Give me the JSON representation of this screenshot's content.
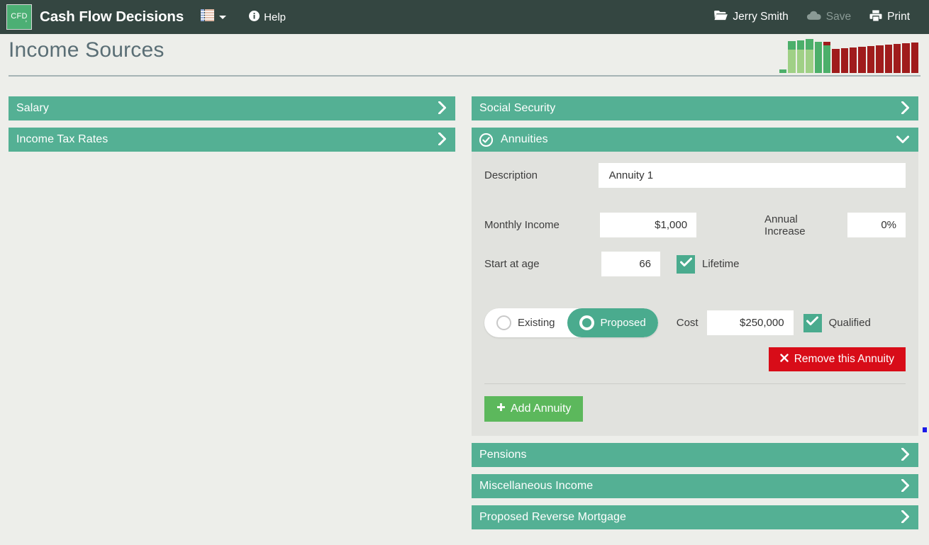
{
  "navbar": {
    "logo_text": "CFD",
    "logo_mark": "’",
    "brand": "Cash Flow Decisions",
    "list_icon": "list-grid-icon",
    "caret_icon": "chevron-down-icon",
    "help_label": "Help",
    "help_icon": "info-circle-icon",
    "user": {
      "label": "Jerry Smith",
      "icon": "open-folder-icon"
    },
    "save": {
      "label": "Save",
      "icon": "cloud-icon",
      "disabled": true
    },
    "print": {
      "label": "Print",
      "icon": "printer-icon"
    }
  },
  "page": {
    "title": "Income Sources",
    "background": "#edeeea",
    "accent": "#54b094"
  },
  "minichart": {
    "type": "bar",
    "title": "",
    "bars": [
      {
        "green_light": 0,
        "green_dark": 5,
        "red": 0
      },
      {
        "green_light": 33,
        "green_dark": 12,
        "red": 0
      },
      {
        "green_light": 33,
        "green_dark": 13,
        "red": 0
      },
      {
        "green_light": 33,
        "green_dark": 15,
        "red": 0
      },
      {
        "green_light": 0,
        "green_dark": 44,
        "red": 0
      },
      {
        "green_light": 0,
        "green_dark": 39,
        "red": 5
      },
      {
        "green_light": 0,
        "green_dark": 0,
        "red": 34
      },
      {
        "green_light": 0,
        "green_dark": 0,
        "red": 35
      },
      {
        "green_light": 0,
        "green_dark": 0,
        "red": 36
      },
      {
        "green_light": 0,
        "green_dark": 0,
        "red": 37
      },
      {
        "green_light": 0,
        "green_dark": 0,
        "red": 38
      },
      {
        "green_light": 0,
        "green_dark": 0,
        "red": 39
      },
      {
        "green_light": 0,
        "green_dark": 0,
        "red": 40
      },
      {
        "green_light": 0,
        "green_dark": 0,
        "red": 41
      },
      {
        "green_light": 0,
        "green_dark": 0,
        "red": 42
      },
      {
        "green_light": 0,
        "green_dark": 0,
        "red": 43
      }
    ],
    "colors": {
      "green_light": "#a0d086",
      "green_dark": "#4caf6a",
      "red": "#a01c1c"
    }
  },
  "left_column": {
    "sections": [
      {
        "label": "Salary",
        "icon": "chevron-right-icon"
      },
      {
        "label": "Income Tax Rates",
        "icon": "chevron-right-icon"
      }
    ]
  },
  "right_column": {
    "social_security": {
      "label": "Social Security",
      "icon": "chevron-right-icon"
    },
    "annuities": {
      "label": "Annuities",
      "status_icon": "check-circle-icon",
      "chevron_icon": "chevron-down-icon",
      "form": {
        "description_label": "Description",
        "description_value": "Annuity 1",
        "monthly_income_label": "Monthly Income",
        "monthly_income_value": "$1,000",
        "annual_increase_label": "Annual Increase",
        "annual_increase_value": "0%",
        "start_age_label": "Start at age",
        "start_age_value": "66",
        "lifetime_label": "Lifetime",
        "lifetime_checked": true,
        "existing_label": "Existing",
        "proposed_label": "Proposed",
        "selected_type": "Proposed",
        "cost_label": "Cost",
        "cost_value": "$250,000",
        "qualified_label": "Qualified",
        "qualified_checked": true,
        "remove_label": "Remove this Annuity",
        "remove_icon": "x-mark-icon",
        "add_label": "Add Annuity",
        "add_icon": "plus-icon"
      }
    },
    "sections_below": [
      {
        "label": "Pensions",
        "icon": "chevron-right-icon"
      },
      {
        "label": "Miscellaneous Income",
        "icon": "chevron-right-icon"
      },
      {
        "label": "Proposed Reverse Mortgage",
        "icon": "chevron-right-icon"
      }
    ]
  }
}
